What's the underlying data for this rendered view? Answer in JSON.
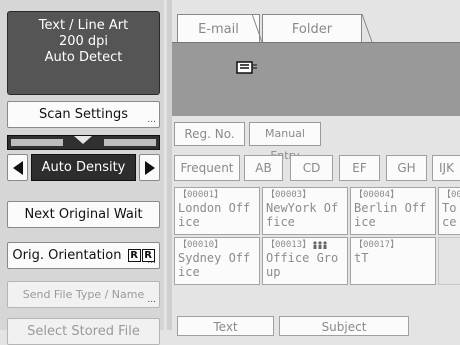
{
  "status": {
    "line1": "Text / Line Art",
    "line2": "200 dpi",
    "line3": "Auto Detect"
  },
  "left_buttons": {
    "scan_settings": "Scan Settings",
    "density": "Auto Density",
    "next_original_wait": "Next Original Wait",
    "orig_orientation": "Orig. Orientation",
    "send_file_type": "Send File Type / Name",
    "select_stored_file": "Select Stored File",
    "more_indicator": "..."
  },
  "density_level": 0.5,
  "tabs": {
    "email": "E-mail",
    "folder": "Folder"
  },
  "toolbar": {
    "reg_no": "Reg. No.",
    "manual_entry": "Manual Entry"
  },
  "index_tabs": [
    "Frequent",
    "AB",
    "CD",
    "EF",
    "GH",
    "IJK"
  ],
  "destinations": [
    {
      "num": "【00001】",
      "line1": "London Off",
      "line2": "ice"
    },
    {
      "num": "【00003】",
      "line1": "NewYork Of",
      "line2": "fice"
    },
    {
      "num": "【00004】",
      "line1": "Berlin Off",
      "line2": "ice"
    },
    {
      "num": "【00",
      "line1": "To",
      "line2": "ce"
    },
    {
      "num": "【00010】",
      "line1": "Sydney Off",
      "line2": "ice"
    },
    {
      "num": "【00013】",
      "line1": "Office Gro",
      "line2": "up"
    },
    {
      "num": "【00017】",
      "line1": "tT",
      "line2": ""
    }
  ],
  "bottom": {
    "text": "Text",
    "subject": "Subject"
  },
  "colors": {
    "status_bg": "#555555",
    "display_bg": "#999999",
    "active_dark": "#2d2d2d"
  }
}
